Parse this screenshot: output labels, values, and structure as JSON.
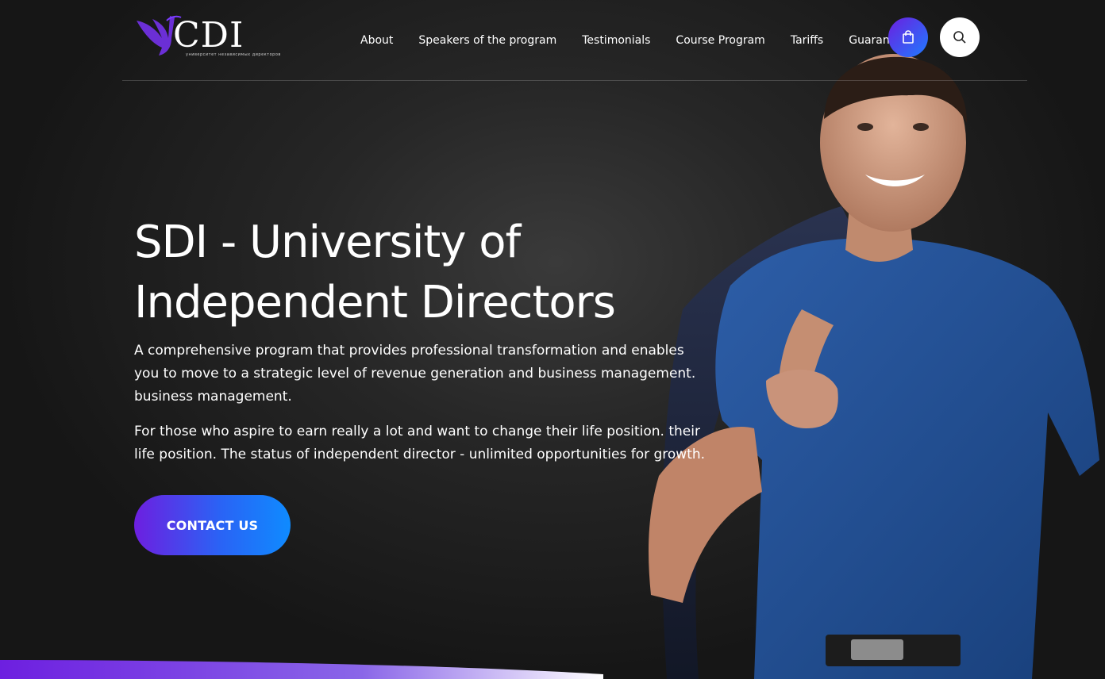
{
  "header": {
    "logo": {
      "text": "CDI",
      "subtitle": "университет независимых директоров"
    },
    "nav": [
      {
        "label": "About"
      },
      {
        "label": "Speakers of the program"
      },
      {
        "label": "Testimonials"
      },
      {
        "label": "Course Program"
      },
      {
        "label": "Tariffs"
      },
      {
        "label": "Guarantees"
      }
    ],
    "cart_icon": "shopping-bag-icon",
    "search_icon": "search-icon"
  },
  "hero": {
    "title": "SDI - University of Independent Directors",
    "paragraph1": "A comprehensive program that provides professional transformation and enables you to move to a strategic level of revenue generation and business management. business management.",
    "paragraph2": "For those who aspire to earn really a lot and want to change their life position. their life position. The status of independent director - unlimited opportunities for growth.",
    "cta_label": "CONTACT US"
  },
  "colors": {
    "accent_start": "#6d1fe0",
    "accent_end": "#0f8bff",
    "background": "#1a1a1a",
    "text": "#ffffff"
  }
}
